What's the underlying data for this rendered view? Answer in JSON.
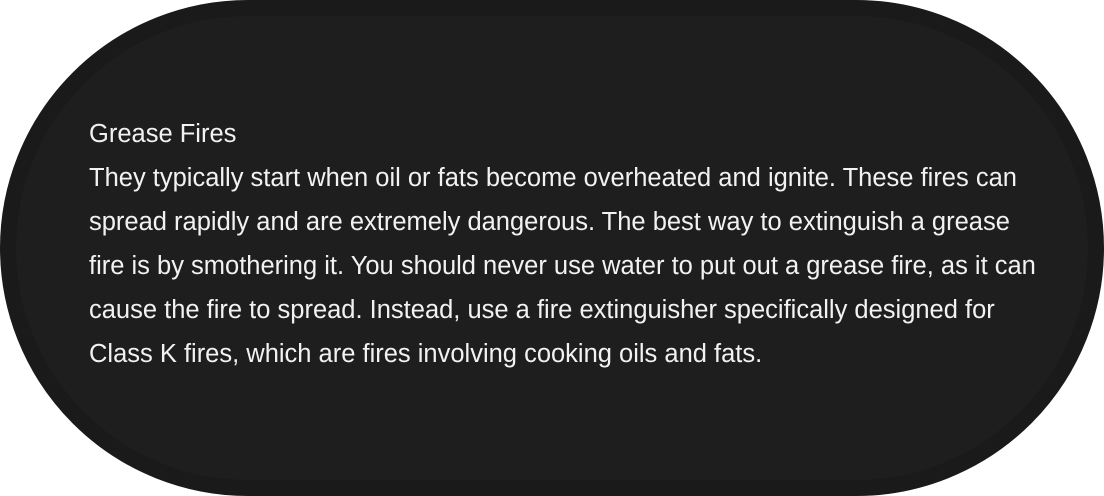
{
  "card": {
    "title": "Grease Fires",
    "body": "They typically start when oil or fats become overheated and ignite. These fires can spread rapidly and are extremely dangerous. The best way to extinguish a grease fire is by smothering it. You should never use water to put out a grease fire, as it can cause the fire to spread. Instead, use a fire extinguisher specifically designed for Class K fires, which are fires involving cooking oils and fats."
  },
  "colors": {
    "background": "#1e1e1e",
    "border": "#1a1a1a",
    "text": "#f2f2f2"
  }
}
